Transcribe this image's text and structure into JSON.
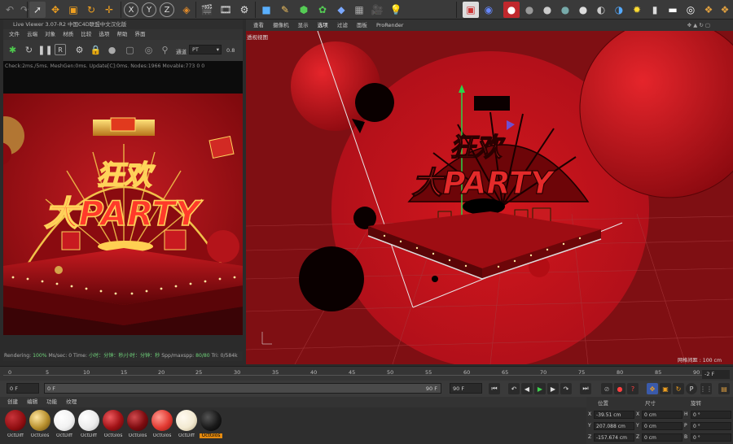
{
  "live_viewer": {
    "title": "Live Viewer 3.07-R2 中国C4D联盟中文汉化版",
    "menu": [
      "文件",
      "云端",
      "对象",
      "材质",
      "比较",
      "选项",
      "帮助",
      "界面"
    ],
    "channel_label": "通道",
    "channel_value": "PT",
    "zoom_value": "0.8",
    "status_text": "Check:2ms./5ms. MeshGen:0ms. Update[C]:0ms. Nodes:1966 Movable:773  0 0",
    "stats": {
      "rendering_label": "Rendering:",
      "rendering_value": "100%",
      "ms_sec": "Ms/sec: 0",
      "time_label": "Time:",
      "time_value": "小时：分钟：秒/小时：分钟：秒",
      "spp_label": "Spp/maxspp:",
      "spp_value": "80/80",
      "tri": "Tri: 0/584k"
    }
  },
  "render_image": {
    "line1": "狂欢",
    "line2": "大PARTY"
  },
  "viewport": {
    "menu": [
      "查看",
      "摄像机",
      "显示",
      "选项",
      "过滤",
      "面板",
      "ProRender"
    ],
    "active_menu": "选项",
    "label": "透视视图",
    "grid_spacing": "网格间距 : 100 cm",
    "text_line1": "狂欢",
    "text_line2": "大PARTY"
  },
  "timeline": {
    "ticks": [
      "0",
      "5",
      "10",
      "15",
      "20",
      "25",
      "30",
      "35",
      "40",
      "45",
      "50",
      "55",
      "60",
      "65",
      "70",
      "75",
      "80",
      "85",
      "90"
    ],
    "current_frame": "-2 F",
    "start_field": "0 F",
    "range_start": "0 F",
    "range_end_marker": "90 F",
    "end_field": "90 F"
  },
  "material_manager": {
    "menu": [
      "创建",
      "编辑",
      "功能",
      "纹理"
    ],
    "materials": [
      {
        "label": "OctDiff",
        "color": "#8e0d10"
      },
      {
        "label": "OctGlos",
        "color": "#b8902e"
      },
      {
        "label": "OctDiff",
        "color": "#f2f2f2"
      },
      {
        "label": "OctDiff",
        "color": "#ececec"
      },
      {
        "label": "OctGlos",
        "color": "#a11216"
      },
      {
        "label": "OctGlos",
        "color": "#7e0c10"
      },
      {
        "label": "OctGlos",
        "color": "#e23a32"
      },
      {
        "label": "OctDiff",
        "color": "#f3ead2"
      },
      {
        "label": "OctGlos",
        "color": "#1a1a1a"
      }
    ],
    "selected_index": 8
  },
  "coordinates": {
    "headers": {
      "position": "位置",
      "size": "尺寸",
      "rotation": "旋转"
    },
    "rows": [
      {
        "axis": "X",
        "pos": "-39.51 cm",
        "size_axis": "X",
        "size": "0 cm",
        "rot_axis": "H",
        "rot": "0 °"
      },
      {
        "axis": "Y",
        "pos": "207.088 cm",
        "size_axis": "Y",
        "size": "0 cm",
        "rot_axis": "P",
        "rot": "0 °"
      },
      {
        "axis": "Z",
        "pos": "-157.674 cm",
        "size_axis": "Z",
        "size": "0 cm",
        "rot_axis": "B",
        "rot": "0 °"
      }
    ]
  },
  "toolbar_icons": [
    "select-icon",
    "move-icon",
    "scale-icon",
    "rotate-icon",
    "live-select-icon",
    "x-axis-icon",
    "y-axis-icon",
    "z-axis-icon",
    "coordinate-system-icon",
    "render-view-icon",
    "render-picture-viewer-icon",
    "render-settings-icon",
    "cube-icon",
    "pen-icon",
    "subdivision-icon",
    "cloner-icon",
    "deformer-icon",
    "floor-icon",
    "camera-icon",
    "light-icon"
  ],
  "accent_color": "#e48a10"
}
